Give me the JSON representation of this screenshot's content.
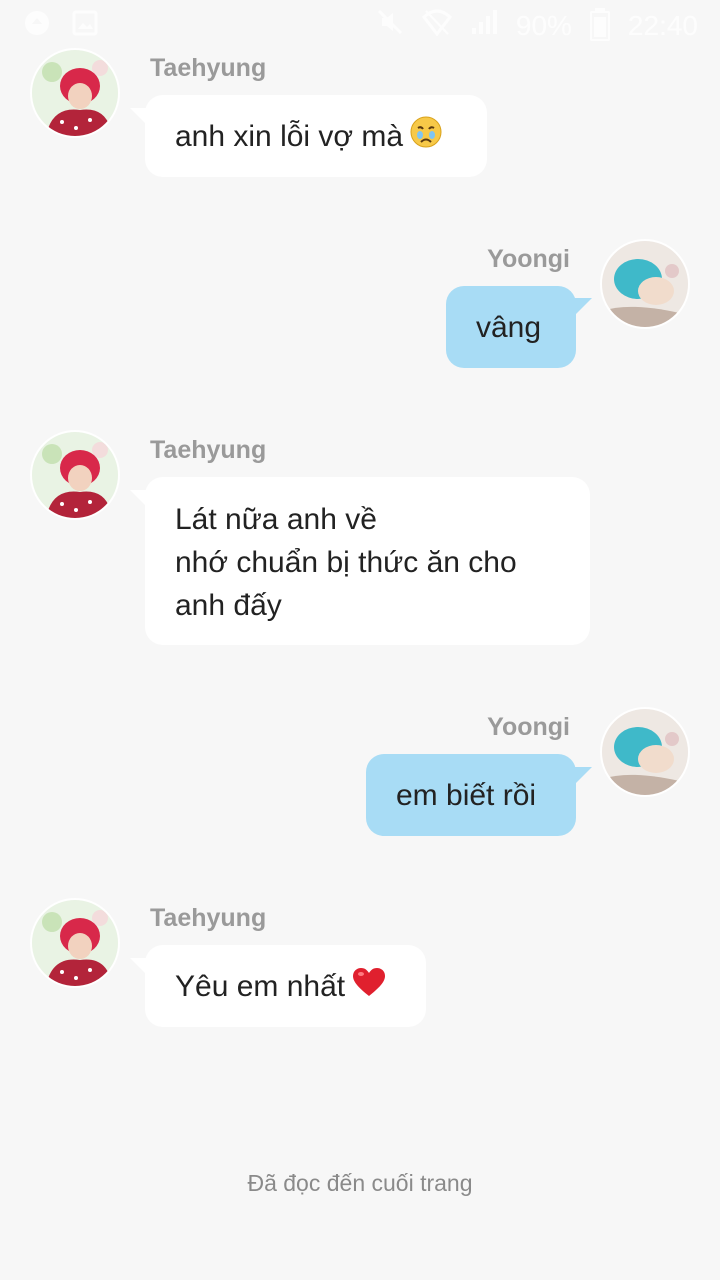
{
  "status_bar": {
    "battery": "90%",
    "time": "22:40",
    "battery_level": 0.9,
    "icons": [
      "app-notification-icon",
      "gallery-icon",
      "mute-icon",
      "wifi-icon",
      "signal-icon",
      "battery-icon"
    ]
  },
  "messages": [
    {
      "sender": "Taehyung",
      "direction": "in",
      "lines": [
        "anh xin lỗi vợ mà"
      ],
      "emoji": "crying-face-emoji"
    },
    {
      "sender": "Yoongi",
      "direction": "out",
      "lines": [
        "vâng"
      ]
    },
    {
      "sender": "Taehyung",
      "direction": "in",
      "lines": [
        "Lát nữa anh về",
        "nhớ chuẩn bị thức ăn cho",
        "anh đấy"
      ]
    },
    {
      "sender": "Yoongi",
      "direction": "out",
      "lines": [
        "em biết rồi"
      ]
    },
    {
      "sender": "Taehyung",
      "direction": "in",
      "lines": [
        "Yêu em nhất"
      ],
      "emoji": "red-heart-emoji"
    }
  ],
  "footer": {
    "end_text": "Đã đọc đến cuối trang"
  },
  "colors": {
    "incoming_bubble": "#ffffff",
    "outgoing_bubble": "#a8dcf5",
    "background": "#f7f7f7",
    "sender_name": "#9a9a9a"
  }
}
